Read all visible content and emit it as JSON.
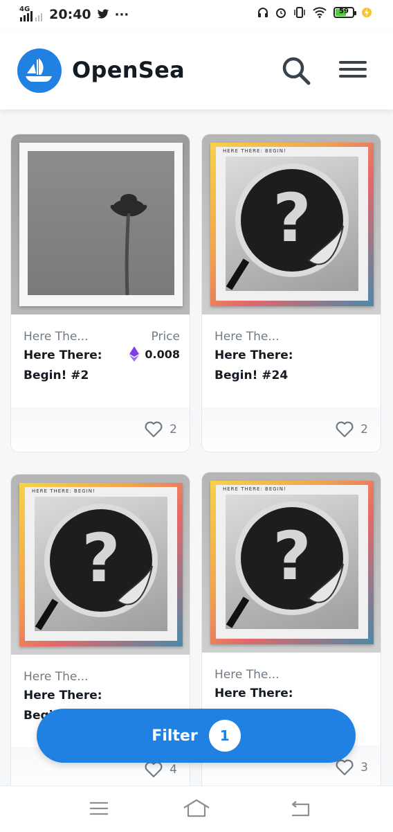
{
  "status_bar": {
    "network": "4G",
    "time": "20:40",
    "battery": "59"
  },
  "header": {
    "brand": "OpenSea",
    "logo_icon": "opensea-ship-icon",
    "search_icon": "search-icon",
    "menu_icon": "hamburger-menu-icon",
    "accent_color": "#2081e2"
  },
  "cards": [
    {
      "collection": "Here The...",
      "name": "Here There: Begin! #2",
      "price_label": "Price",
      "price": "0.008",
      "likes": "2",
      "art": "palm-tree-photo"
    },
    {
      "collection": "Here The...",
      "name": "Here There: Begin! #24",
      "likes": "2",
      "art": "question-mark-sticker",
      "art_text": "HERE THERE: BEGIN!"
    },
    {
      "collection": "Here The...",
      "name": "Here There: Begi",
      "likes": "4",
      "art": "question-mark-sticker",
      "art_text": "HERE THERE: BEGIN!"
    },
    {
      "collection": "Here The...",
      "name": "Here There:",
      "likes": "3",
      "art": "question-mark-sticker",
      "art_text": "HERE THERE: BEGIN!"
    }
  ],
  "filter": {
    "label": "Filter",
    "count": "1"
  }
}
